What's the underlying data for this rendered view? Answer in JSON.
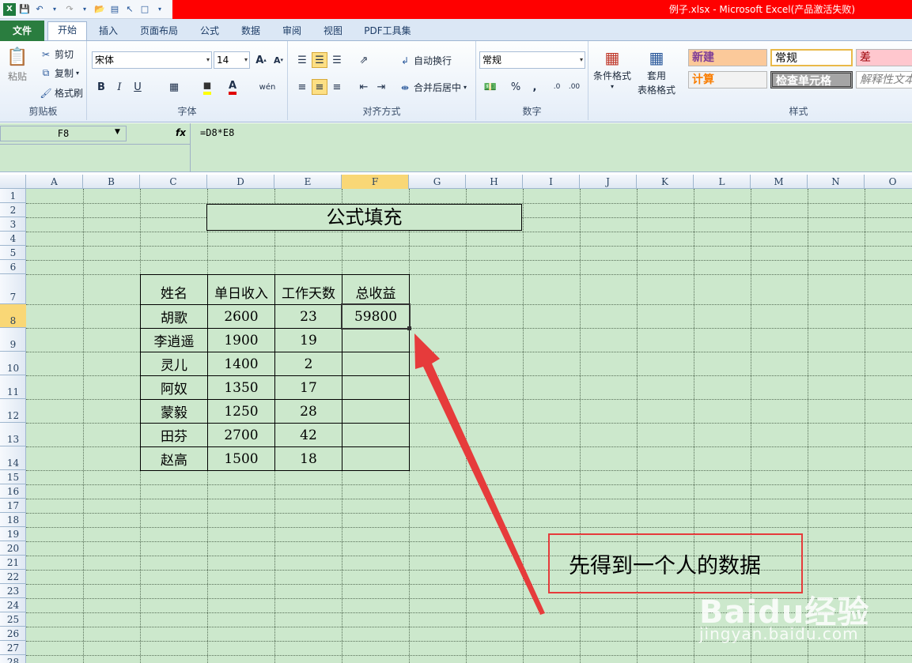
{
  "window": {
    "title": "例子.xlsx - Microsoft Excel(产品激活失败)"
  },
  "tabs": [
    {
      "label": "文件"
    },
    {
      "label": "开始"
    },
    {
      "label": "插入"
    },
    {
      "label": "页面布局"
    },
    {
      "label": "公式"
    },
    {
      "label": "数据"
    },
    {
      "label": "审阅"
    },
    {
      "label": "视图"
    },
    {
      "label": "PDF工具集"
    }
  ],
  "ribbon": {
    "clipboard": {
      "label": "剪贴板",
      "paste": "粘贴",
      "cut": "剪切",
      "copy": "复制",
      "format_painter": "格式刷"
    },
    "font": {
      "label": "字体",
      "name": "宋体",
      "size": "14"
    },
    "alignment": {
      "label": "对齐方式",
      "wrap": "自动换行",
      "merge": "合并后居中"
    },
    "number": {
      "label": "数字",
      "format": "常规"
    },
    "cond": {
      "conditional": "条件格式",
      "table1": "套用",
      "table2": "表格格式"
    },
    "styles": {
      "label": "样式",
      "cells": [
        {
          "name": "新建",
          "color": "#7f3d97",
          "bg": "#fbc99a"
        },
        {
          "name": "常规",
          "color": "#000000",
          "bg": "#ffffff"
        },
        {
          "name": "差",
          "color": "#9c0006",
          "bg": "#ffc7ce"
        },
        {
          "name": "计算",
          "color": "#fa7d00",
          "bg": "#f2f2f2"
        },
        {
          "name": "检查单元格",
          "color": "#ffffff",
          "bg": "#a5a5a5"
        },
        {
          "name": "解释性文本",
          "color": "#7f7f7f",
          "bg": "#ffffff"
        }
      ]
    }
  },
  "formula_bar": {
    "name_box": "F8",
    "fx": "fx",
    "formula": "=D8*E8"
  },
  "columns": [
    "A",
    "B",
    "C",
    "D",
    "E",
    "F",
    "G",
    "H",
    "I",
    "J",
    "K",
    "L",
    "M",
    "N",
    "O"
  ],
  "rows": [
    "1",
    "2",
    "3",
    "4",
    "5",
    "6",
    "7",
    "8",
    "9",
    "10",
    "11",
    "12",
    "13",
    "14",
    "15",
    "16",
    "17",
    "18",
    "19",
    "20",
    "21",
    "22",
    "23",
    "24",
    "25",
    "26",
    "27",
    "28"
  ],
  "sheet": {
    "title": "公式填充",
    "headers": [
      "姓名",
      "单日收入",
      "工作天数",
      "总收益"
    ],
    "records": [
      [
        "胡歌",
        "2600",
        "23",
        "59800"
      ],
      [
        "李逍遥",
        "1900",
        "19",
        ""
      ],
      [
        "灵儿",
        "1400",
        "2",
        ""
      ],
      [
        "阿奴",
        "1350",
        "17",
        ""
      ],
      [
        "蒙毅",
        "1250",
        "28",
        ""
      ],
      [
        "田芬",
        "2700",
        "42",
        ""
      ],
      [
        "赵高",
        "1500",
        "18",
        ""
      ]
    ]
  },
  "annotation": {
    "callout": "先得到一个人的数据",
    "arrow_color": "#e63b3b"
  },
  "watermark": {
    "brand": "Baidu经验",
    "url": "jingyan.baidu.com"
  },
  "colors": {
    "sheet_bg": "#cce8cc",
    "title_bar": "#ff0000",
    "file_tab": "#2a7d3f",
    "selection": "#f9d776"
  }
}
